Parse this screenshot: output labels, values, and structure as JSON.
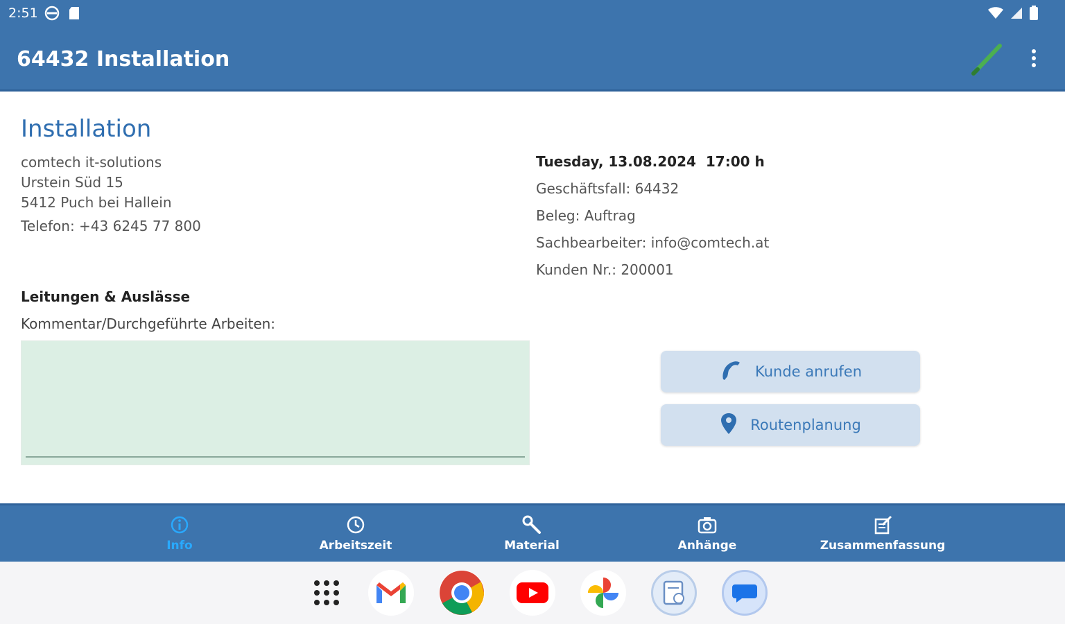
{
  "status_bar": {
    "time": "2:51"
  },
  "app_bar": {
    "title": "64432 Installation"
  },
  "info": {
    "heading": "Installation",
    "address": [
      "comtech it-solutions",
      "Urstein Süd 15",
      "5412 Puch bei Hallein"
    ],
    "phone_label": "Telefon:",
    "phone_value": "+43 6245 77 800",
    "date": "Tuesday, 13.08.2024",
    "time": "17:00 h",
    "case_label": "Geschäftsfall:",
    "case_value": "64432",
    "doc_label": "Beleg:",
    "doc_value": "Auftrag",
    "agent_label": "Sachbearbeiter:",
    "agent_value": "info@comtech.at",
    "customer_label": "Kunden Nr.:",
    "customer_value": "200001",
    "section_title": "Leitungen & Auslässe",
    "comment_label": "Kommentar/Durchgeführte Arbeiten:",
    "comment_value": ""
  },
  "actions": {
    "call_label": "Kunde anrufen",
    "route_label": "Routenplanung"
  },
  "bottom_nav": {
    "active_color": "#29a9ff",
    "items": [
      {
        "label": "Info",
        "icon": "info-icon",
        "active": true
      },
      {
        "label": "Arbeitszeit",
        "icon": "clock-icon",
        "active": false
      },
      {
        "label": "Material",
        "icon": "wrench-icon",
        "active": false
      },
      {
        "label": "Anhänge",
        "icon": "camera-icon",
        "active": false
      },
      {
        "label": "Zusammenfassung",
        "icon": "summary-icon",
        "active": false
      }
    ]
  },
  "dock": {
    "apps": [
      "app-drawer",
      "gmail",
      "chrome",
      "youtube",
      "photos",
      "files",
      "messages"
    ]
  },
  "colors": {
    "primary": "#3d74ad",
    "accent": "#2f6eb0",
    "comment_bg": "#dcefe4",
    "button_bg": "#d2e0ef"
  }
}
